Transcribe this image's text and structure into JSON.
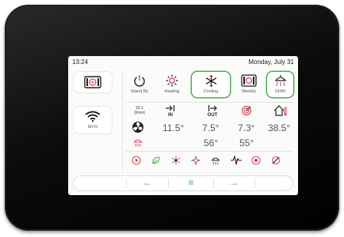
{
  "status": {
    "time": "13:24",
    "date": "Monday, July 31"
  },
  "left": {
    "wifi_label": "Wi-Fi"
  },
  "modes": [
    {
      "label": "Stand By",
      "icon": "power-icon"
    },
    {
      "label": "Heating",
      "icon": "sun-icon"
    },
    {
      "label": "Cooling",
      "icon": "snowflake-icon",
      "selected": true
    },
    {
      "label": "Weekly",
      "icon": "calendar-icon"
    },
    {
      "label": "DHW",
      "icon": "shower-icon",
      "selected": true
    }
  ],
  "readings": {
    "flow_value": "18.1",
    "flow_unit": "[l/min]",
    "in_label": "IN",
    "out_label": "OUT",
    "fan_in": "11.5°",
    "fan_out": "7.5°",
    "target": "7.3°",
    "house": "38.5°",
    "dhw_out": "56°",
    "dhw_target": "55°"
  },
  "colors": {
    "accent": "#e04a55",
    "selected_border": "#4caf50",
    "menu_green": "#47b560"
  },
  "nav": {
    "back": "←",
    "menu": "≡",
    "forward": "→"
  }
}
